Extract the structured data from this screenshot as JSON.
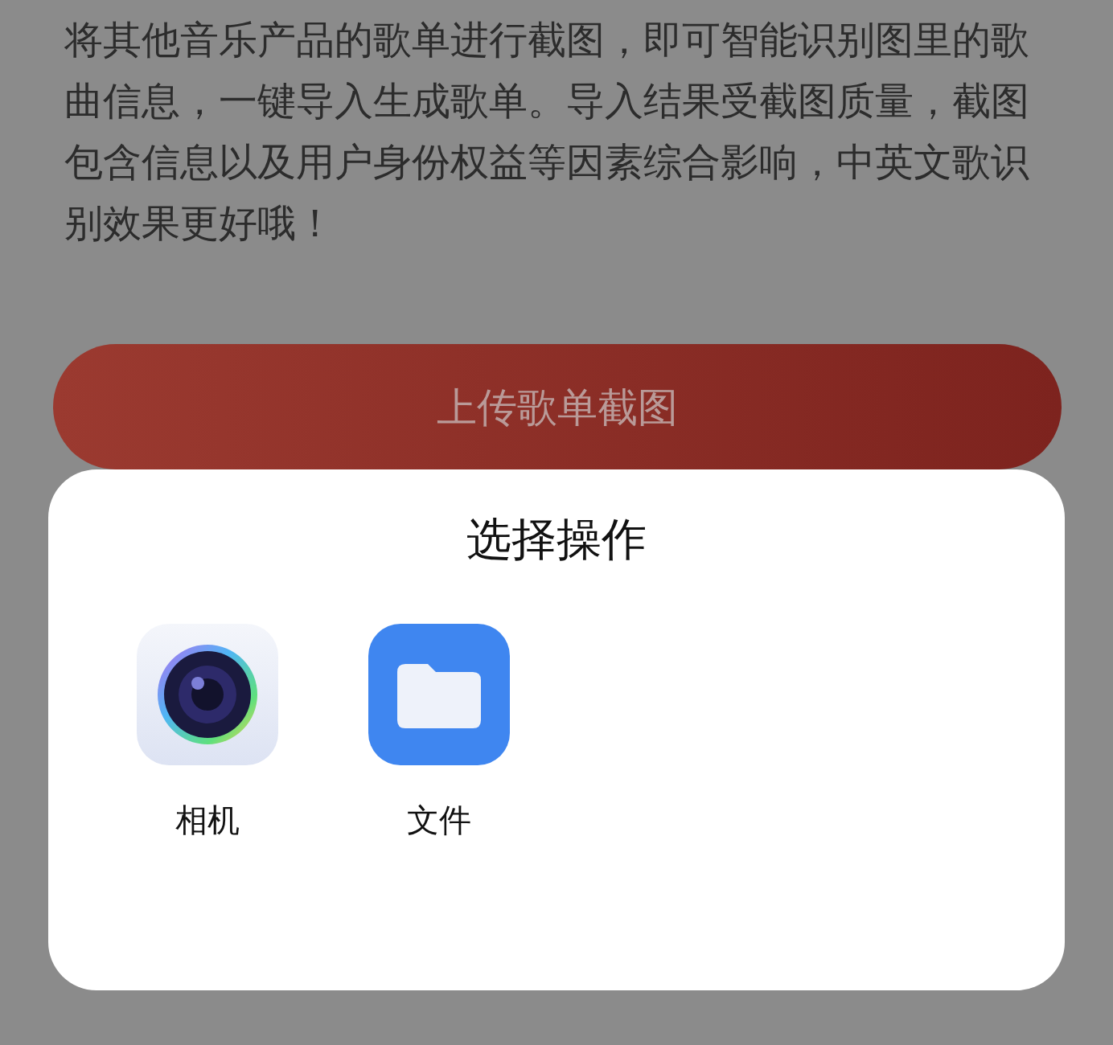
{
  "intro": "将其他音乐产品的歌单进行截图，即可智能识别图里的歌曲信息，一键导入生成歌单。导入结果受截图质量，截图包含信息以及用户身份权益等因素综合影响，中英文歌识别效果更好哦！",
  "upload_button": "上传歌单截图",
  "sheet": {
    "title": "选择操作",
    "options": [
      {
        "label": "相机",
        "kind": "camera"
      },
      {
        "label": "文件",
        "kind": "files"
      }
    ]
  }
}
